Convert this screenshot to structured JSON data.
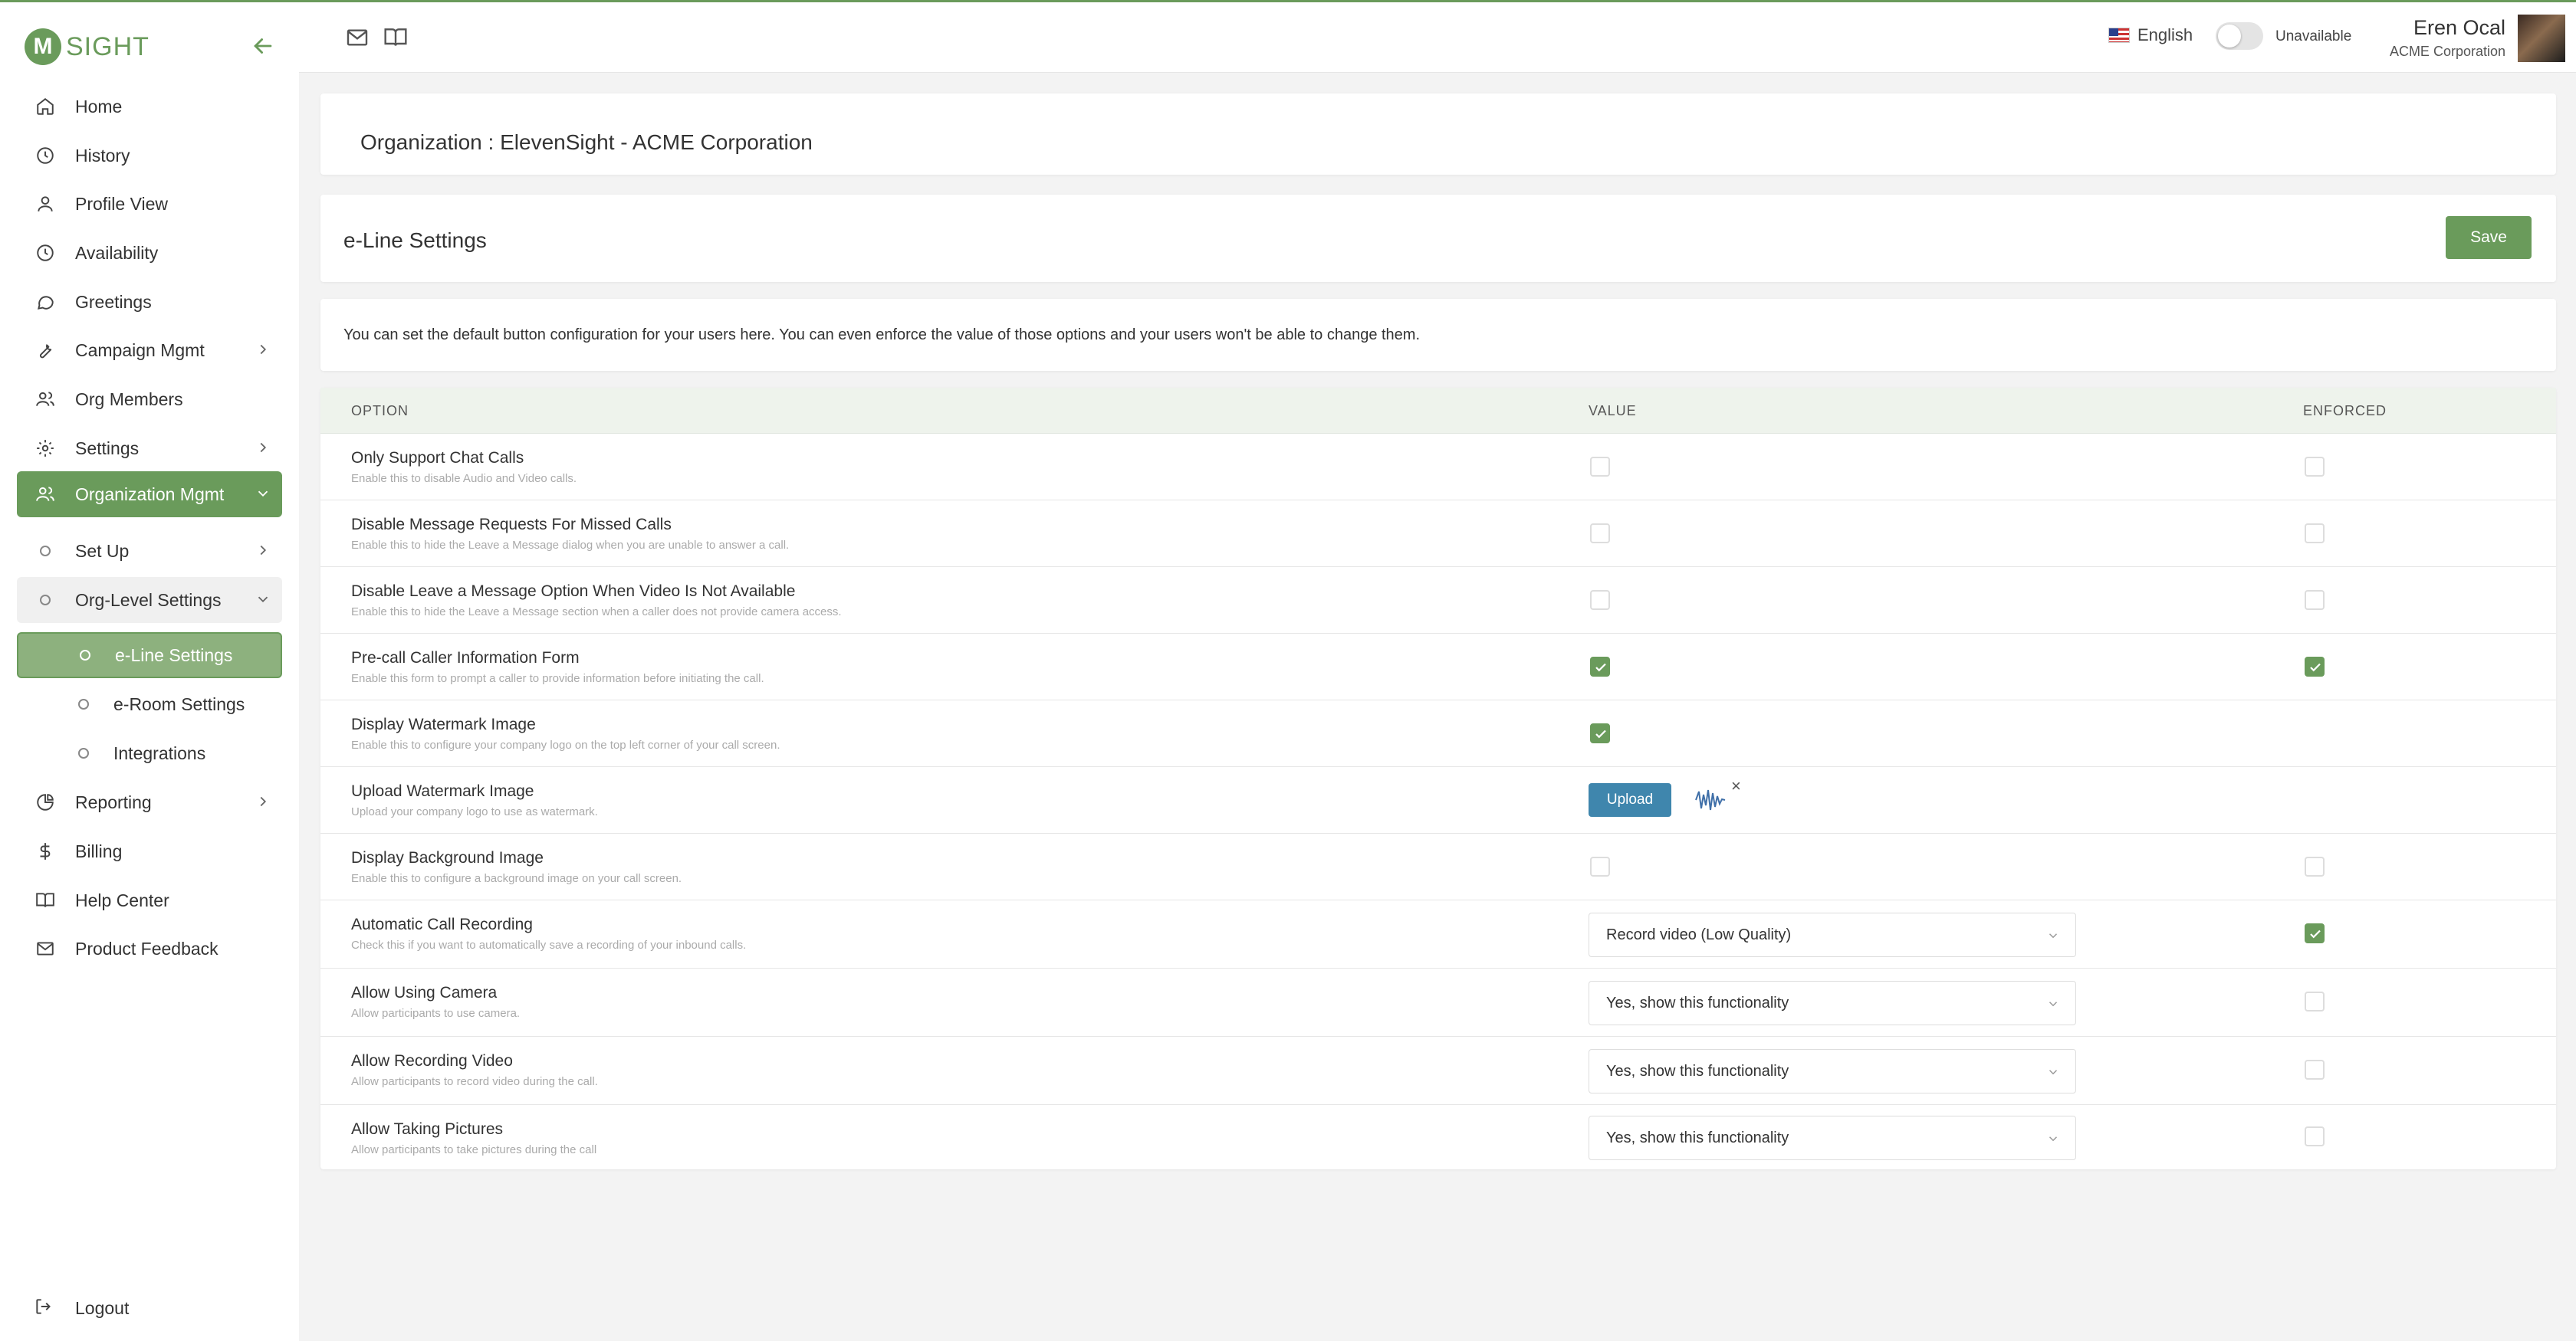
{
  "app": {
    "logo_letter": "M",
    "logo_text": "SIGHT",
    "brand_color": "#6a9b5b"
  },
  "sidebar": {
    "items": [
      {
        "label": "Home",
        "icon": "home-icon"
      },
      {
        "label": "History",
        "icon": "clock-icon"
      },
      {
        "label": "Profile View",
        "icon": "user-icon"
      },
      {
        "label": "Availability",
        "icon": "clock-icon"
      },
      {
        "label": "Greetings",
        "icon": "chat-bubble-icon"
      },
      {
        "label": "Campaign Mgmt",
        "icon": "wrench-icon"
      },
      {
        "label": "Org Members",
        "icon": "users-icon"
      },
      {
        "label": "Settings",
        "icon": "gear-icon"
      },
      {
        "label": "Organization Mgmt",
        "icon": "users-icon"
      },
      {
        "label": "Set Up",
        "icon": "circle-icon"
      },
      {
        "label": "Org-Level Settings",
        "icon": "circle-icon"
      },
      {
        "label": "e-Line Settings",
        "icon": "circle-icon"
      },
      {
        "label": "e-Room Settings",
        "icon": "circle-icon"
      },
      {
        "label": "Integrations",
        "icon": "circle-icon"
      },
      {
        "label": "Reporting",
        "icon": "pie-chart-icon"
      },
      {
        "label": "Billing",
        "icon": "dollar-icon"
      },
      {
        "label": "Help Center",
        "icon": "book-icon"
      },
      {
        "label": "Product Feedback",
        "icon": "mail-icon"
      }
    ],
    "logout_label": "Logout"
  },
  "header": {
    "language": "English",
    "status": "Unavailable",
    "user_name": "Eren Ocal",
    "user_org": "ACME Corporation"
  },
  "org": {
    "title": "Organization : ElevenSight - ACME Corporation"
  },
  "settings": {
    "title": "e-Line Settings",
    "save_label": "Save",
    "description": "You can set the default button configuration for your users here. You can even enforce the value of those options and your users won't be able to change them."
  },
  "table": {
    "headers": {
      "option": "OPTION",
      "value": "VALUE",
      "enforced": "ENFORCED"
    },
    "rows": [
      {
        "title": "Only Support Chat Calls",
        "desc": "Enable this to disable Audio and Video calls.",
        "value_checked": false,
        "enforced": false
      },
      {
        "title": "Disable Message Requests For Missed Calls",
        "desc": "Enable this to hide the Leave a Message dialog when you are unable to answer a call.",
        "value_checked": false,
        "enforced": false
      },
      {
        "title": "Disable Leave a Message Option When Video Is Not Available",
        "desc": "Enable this to hide the Leave a Message section when a caller does not provide camera access.",
        "value_checked": false,
        "enforced": false
      },
      {
        "title": "Pre-call Caller Information Form",
        "desc": "Enable this form to prompt a caller to provide information before initiating the call.",
        "value_checked": true,
        "enforced": true
      },
      {
        "title": "Display Watermark Image",
        "desc": "Enable this to configure your company logo on the top left corner of your call screen.",
        "value_checked": true
      },
      {
        "title": "Upload Watermark Image",
        "desc": "Upload your company logo to use as watermark.",
        "upload_label": "Upload",
        "remove_glyph": "×"
      },
      {
        "title": "Display Background Image",
        "desc": "Enable this to configure a background image on your call screen.",
        "value_checked": false,
        "enforced": false
      },
      {
        "title": "Automatic Call Recording",
        "desc": "Check this if you want to automatically save a recording of your inbound calls.",
        "select": "Record video (Low Quality)",
        "enforced": true
      },
      {
        "title": "Allow Using Camera",
        "desc": "Allow participants to use camera.",
        "select": "Yes, show this functionality",
        "enforced": false
      },
      {
        "title": "Allow Recording Video",
        "desc": "Allow participants to record video during the call.",
        "select": "Yes, show this functionality",
        "enforced": false
      },
      {
        "title": "Allow Taking Pictures",
        "desc": "Allow participants to take pictures during the call",
        "select": "Yes, show this functionality",
        "enforced": false
      }
    ]
  }
}
